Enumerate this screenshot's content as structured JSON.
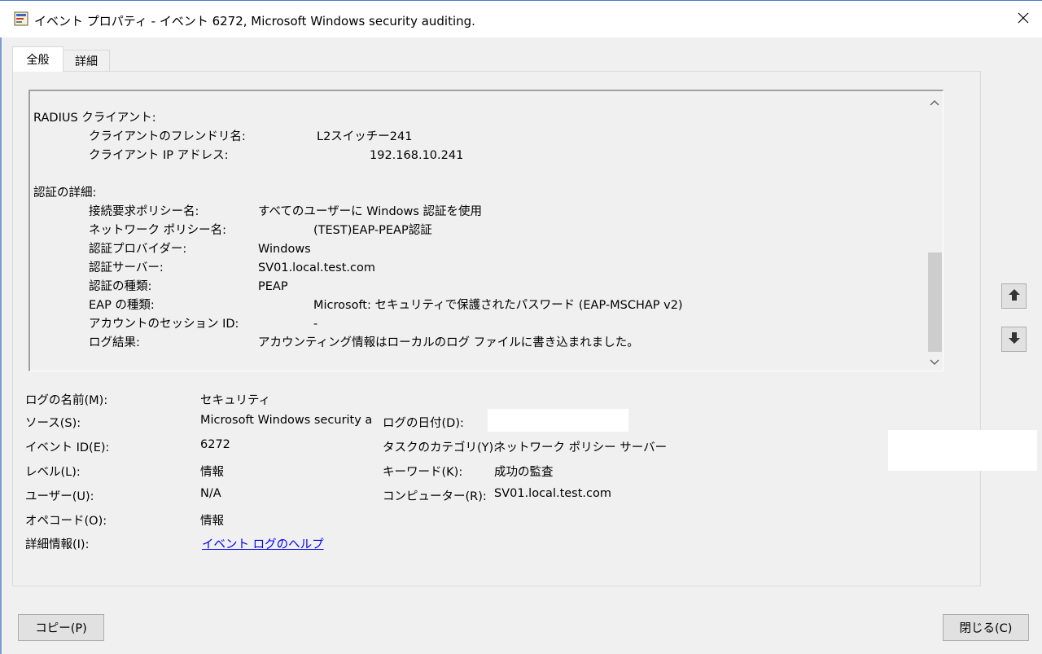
{
  "window": {
    "title": "イベント プロパティ - イベント 6272, Microsoft Windows security auditing."
  },
  "tabs": [
    {
      "label": "全般",
      "selected": true
    },
    {
      "label": "詳細",
      "selected": false
    }
  ],
  "description": {
    "radius_header": "RADIUS クライアント:",
    "friendly_name_label": "クライアントのフレンドリ名:",
    "friendly_name_value": "L2スイッチー241",
    "client_ip_label": "クライアント IP アドレス:",
    "client_ip_value": "192.168.10.241",
    "auth_header": "認証の詳細:",
    "conn_policy_label": "接続要求ポリシー名:",
    "conn_policy_value": "すべてのユーザーに Windows 認証を使用",
    "net_policy_label": "ネットワーク ポリシー名:",
    "net_policy_value": "(TEST)EAP-PEAP認証",
    "auth_provider_label": "認証プロバイダー:",
    "auth_provider_value": "Windows",
    "auth_server_label": "認証サーバー:",
    "auth_server_value": "SV01.local.test.com",
    "auth_type_label": "認証の種類:",
    "auth_type_value": "PEAP",
    "eap_type_label": "EAP の種類:",
    "eap_type_value": "Microsoft: セキュリティで保護されたパスワード (EAP-MSCHAP v2)",
    "session_id_label": "アカウントのセッション ID:",
    "session_id_value": "-",
    "log_result_label": "ログ結果:",
    "log_result_value": "アカウンティング情報はローカルのログ ファイルに書き込まれました。"
  },
  "fields": {
    "log_name_label": "ログの名前(M):",
    "log_name_value": "セキュリティ",
    "source_label": "ソース(S):",
    "source_value": "Microsoft Windows security a",
    "log_date_label": "ログの日付(D):",
    "event_id_label": "イベント ID(E):",
    "event_id_value": "6272",
    "task_category_label": "タスクのカテゴリ(Y):",
    "task_category_value": "ネットワーク ポリシー サーバー",
    "level_label": "レベル(L):",
    "level_value": "情報",
    "keyword_label": "キーワード(K):",
    "keyword_value": "成功の監査",
    "user_label": "ユーザー(U):",
    "user_value": "N/A",
    "computer_label": "コンピューター(R):",
    "computer_value": "SV01.local.test.com",
    "opcode_label": "オペコード(O):",
    "opcode_value": "情報",
    "more_info_label": "詳細情報(I):",
    "more_info_link": "イベント ログのヘルプ"
  },
  "buttons": {
    "copy": "コピー(P)",
    "close": "閉じる(C)"
  },
  "icons": {
    "app": "event-viewer-icon",
    "close": "close-icon",
    "prev": "arrow-up-icon",
    "next": "arrow-down-icon"
  }
}
